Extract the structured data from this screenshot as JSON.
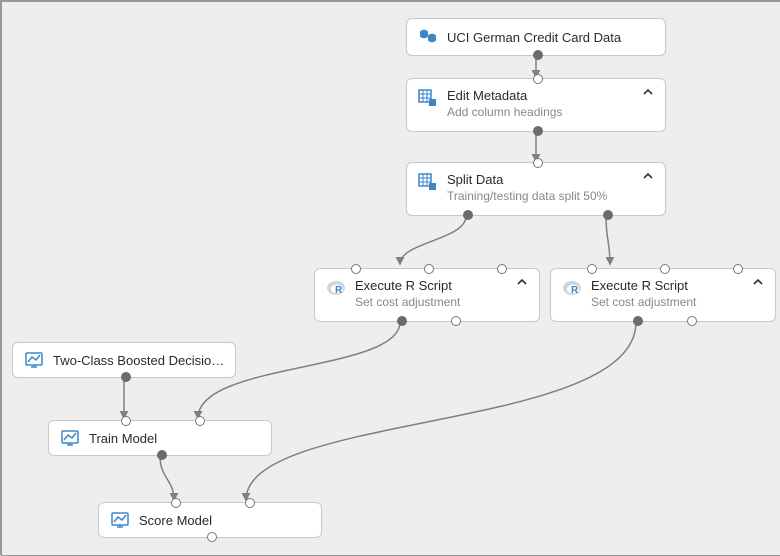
{
  "nodes": {
    "n1": {
      "title": "UCI German Credit Card Data"
    },
    "n2": {
      "title": "Edit Metadata",
      "sub": "Add column headings"
    },
    "n3": {
      "title": "Split Data",
      "sub": "Training/testing data split 50%"
    },
    "n4": {
      "title": "Execute R Script",
      "sub": "Set cost adjustment"
    },
    "n5": {
      "title": "Execute R Script",
      "sub": "Set cost adjustment"
    },
    "n6": {
      "title": "Two-Class Boosted Decision..."
    },
    "n7": {
      "title": "Train Model"
    },
    "n8": {
      "title": "Score Model"
    }
  },
  "colors": {
    "iconBlue": "#3b87c8",
    "edge": "#808080"
  }
}
